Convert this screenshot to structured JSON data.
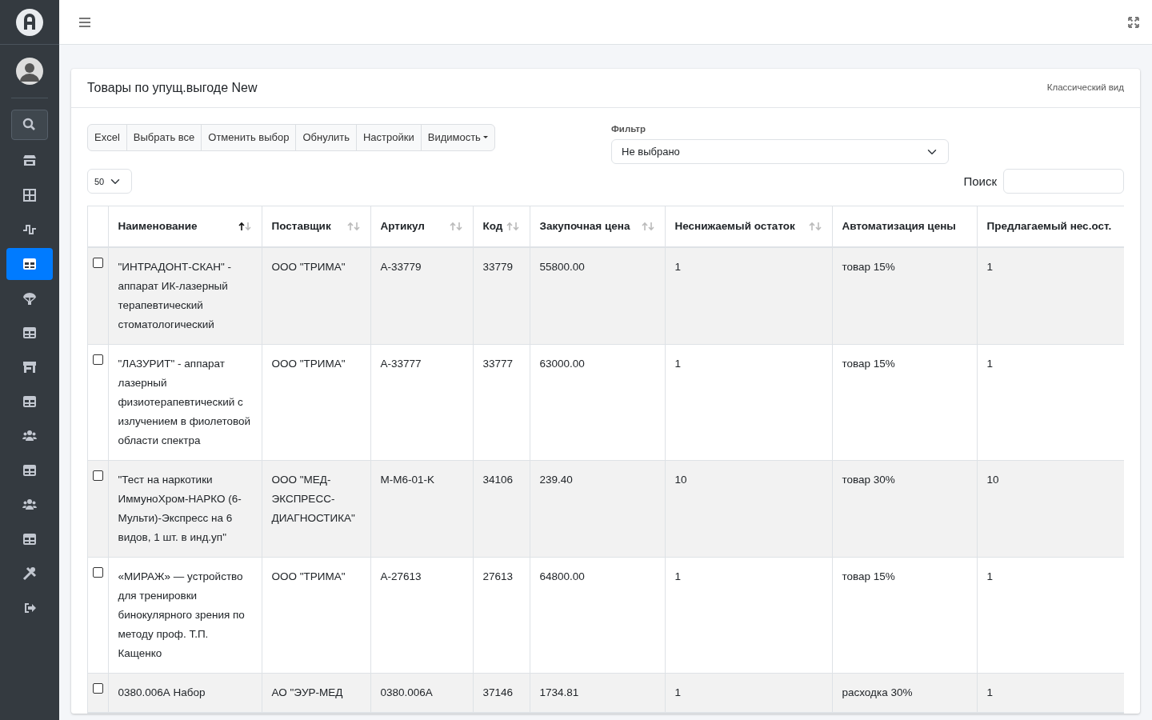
{
  "sidebar": {
    "items": [
      {
        "kind": "search",
        "selected": false
      },
      {
        "kind": "store",
        "selected": false
      },
      {
        "kind": "grid",
        "selected": false
      },
      {
        "kind": "pulse",
        "selected": false
      },
      {
        "kind": "table",
        "selected": true
      },
      {
        "kind": "parachute",
        "selected": false
      },
      {
        "kind": "table",
        "selected": false
      },
      {
        "kind": "shop",
        "selected": false
      },
      {
        "kind": "table",
        "selected": false
      },
      {
        "kind": "users",
        "selected": false
      },
      {
        "kind": "table",
        "selected": false
      },
      {
        "kind": "users",
        "selected": false
      },
      {
        "kind": "table",
        "selected": false
      },
      {
        "kind": "tools",
        "selected": false
      },
      {
        "kind": "logout",
        "selected": false
      }
    ]
  },
  "card": {
    "title": "Товары по упущ.выгоде New",
    "view_link": "Классический вид"
  },
  "toolbar": {
    "buttons": [
      {
        "label": "Excel",
        "kind": "plain"
      },
      {
        "label": "Выбрать все",
        "kind": "plain"
      },
      {
        "label": "Отменить выбор",
        "kind": "plain"
      },
      {
        "label": "Обнулить",
        "kind": "plain"
      },
      {
        "label": "Настройки",
        "kind": "plain"
      },
      {
        "label": "Видимость",
        "kind": "dropdown"
      }
    ]
  },
  "filter": {
    "label": "Фильтр",
    "value": "Не выбрано"
  },
  "page_size": "50",
  "search": {
    "label": "Поиск"
  },
  "table": {
    "columns": [
      {
        "label": "Наименование",
        "sorted": true
      },
      {
        "label": "Поставщик",
        "sorted": false
      },
      {
        "label": "Артикул",
        "sorted": false
      },
      {
        "label": "Код",
        "sorted": false
      },
      {
        "label": "Закупочная цена",
        "sorted": false
      },
      {
        "label": "Неснижаемый остаток",
        "sorted": false
      },
      {
        "label": "Автоматизация цены"
      },
      {
        "label": "Предлагаемый нес.ост."
      }
    ],
    "rows": [
      {
        "selected": false,
        "cells": [
          "\"ИНТРАДОНТ-СКАН\" - аппарат ИК-лазерный терапевтический стоматологический",
          "ООО \"ТРИМА\"",
          "A-33779",
          "33779",
          "55800.00",
          "1",
          "товар 15%",
          "1"
        ]
      },
      {
        "selected": false,
        "cells": [
          "\"ЛАЗУРИТ\" - аппарат лазерный физиотерапевтический с излучением в фиолетовой области спектра",
          "ООО \"ТРИМА\"",
          "A-33777",
          "33777",
          "63000.00",
          "1",
          "товар 15%",
          "1"
        ]
      },
      {
        "selected": false,
        "cells": [
          "\"Тест на наркотики ИммуноХром-НАРКО (6-Мульти)-Экспресс на 6 видов, 1 шт. в инд.уп\"",
          "ООО \"МЕД-ЭКСПРЕСС-ДИАГНОСТИКА\"",
          "M-M6-01-K",
          "34106",
          "239.40",
          "10",
          "товар 30%",
          "10"
        ]
      },
      {
        "selected": false,
        "cells": [
          "«МИРАЖ» — устройство для тренировки бинокулярного зрения по методу проф. Т.П. Кащенко",
          "ООО \"ТРИМА\"",
          "A-27613",
          "27613",
          "64800.00",
          "1",
          "товар 15%",
          "1"
        ]
      },
      {
        "selected": false,
        "cells": [
          "0380.006А Набор",
          "АО \"ЭУР-МЕД",
          "0380.006A",
          "37146",
          "1734.81",
          "1",
          "расходка 30%",
          "1"
        ]
      }
    ]
  }
}
